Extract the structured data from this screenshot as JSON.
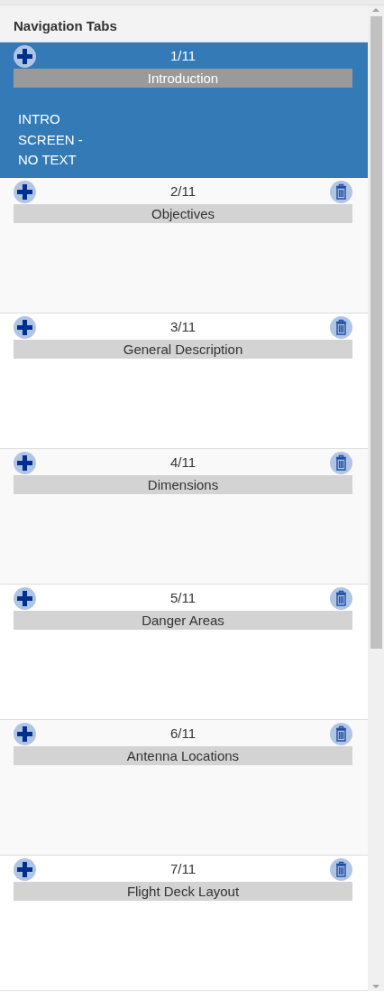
{
  "panel": {
    "title": "Navigation Tabs"
  },
  "slides": [
    {
      "number": "1/11",
      "title": "Introduction",
      "body": "INTRO SCREEN - NO TEXT",
      "selected": true,
      "deletable": false
    },
    {
      "number": "2/11",
      "title": "Objectives",
      "selected": false,
      "deletable": true
    },
    {
      "number": "3/11",
      "title": "General Description",
      "selected": false,
      "deletable": true
    },
    {
      "number": "4/11",
      "title": "Dimensions",
      "selected": false,
      "deletable": true
    },
    {
      "number": "5/11",
      "title": "Danger Areas",
      "selected": false,
      "deletable": true
    },
    {
      "number": "6/11",
      "title": "Antenna Locations",
      "selected": false,
      "deletable": true
    },
    {
      "number": "7/11",
      "title": "Flight Deck Layout",
      "selected": false,
      "deletable": true
    }
  ]
}
